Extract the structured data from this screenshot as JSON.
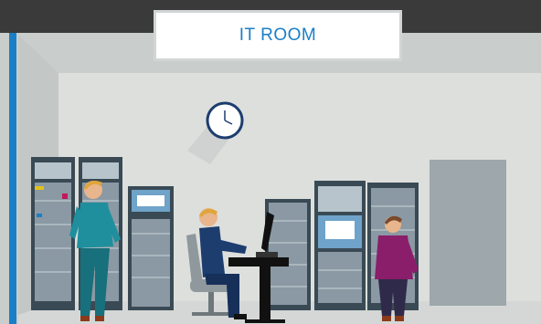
{
  "sign": {
    "text": "IT ROOM"
  },
  "colors": {
    "ceiling": "#3b3a3b",
    "wall": "#c9cdcb",
    "back_wall": "#dcdfdc",
    "floor": "#d4d7d6",
    "accent_blue": "#1a7fc6",
    "rack_dark": "#3a4a55",
    "rack_light": "#b8c4cc",
    "door": "#9ea7ab",
    "worker_teal": "#1f8f9d",
    "worker_navy": "#1d3d6e",
    "worker_purple": "#8a1e6a"
  },
  "scene": {
    "elements": [
      "ceiling",
      "sign",
      "wall-clock",
      "server-racks",
      "monitors",
      "desk",
      "office-chair",
      "door",
      "three-workers"
    ]
  }
}
